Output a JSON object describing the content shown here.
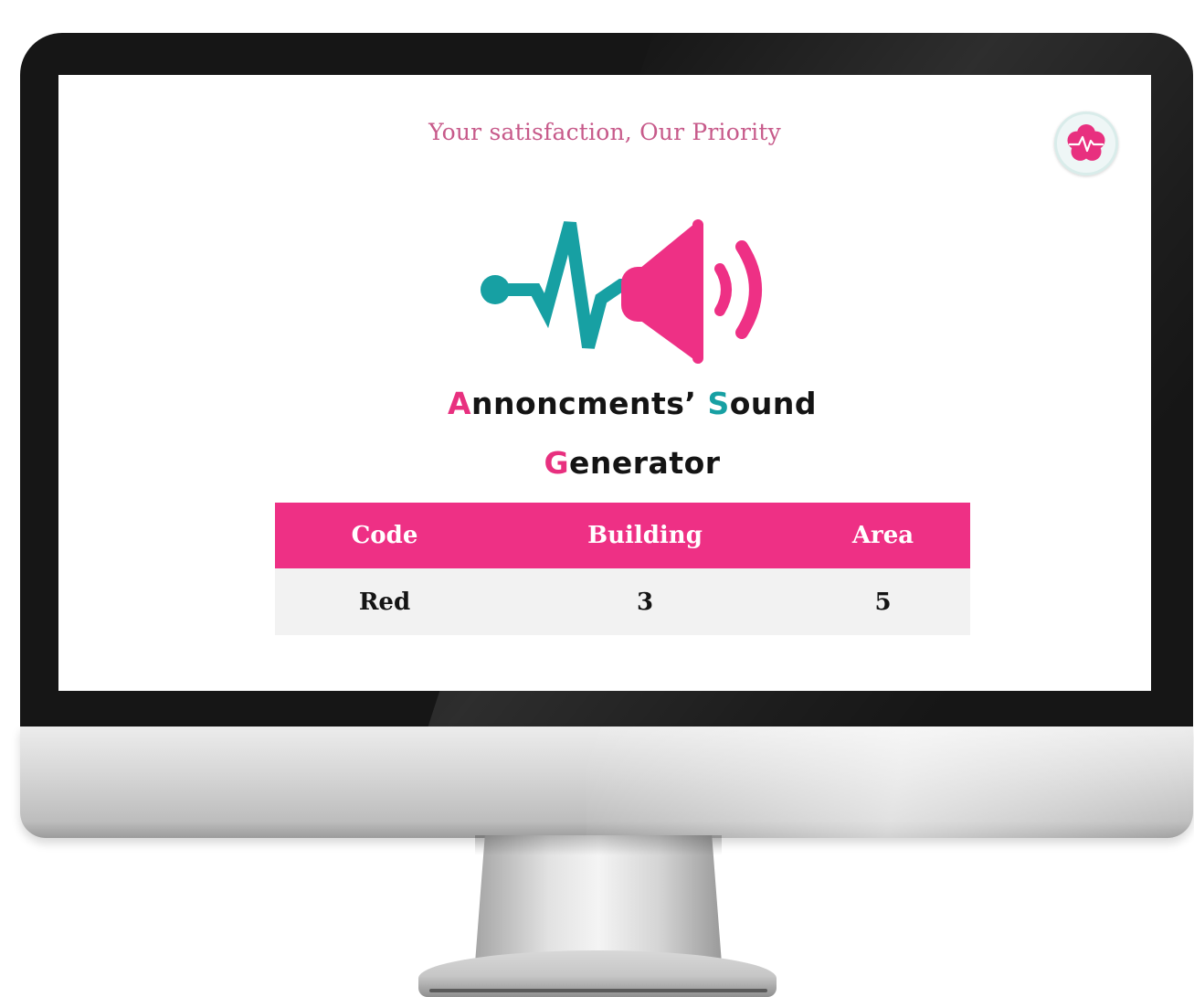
{
  "screen": {
    "tagline": "Your satisfaction, Our Priority",
    "title": {
      "line1_accent": "A",
      "line1_rest_a": "nnoncments’ ",
      "line1_accent2": "S",
      "line1_rest_b": "ound",
      "line2_accent": "G",
      "line2_rest": "enerator"
    },
    "table": {
      "headers": [
        "Code",
        "Building",
        "Area"
      ],
      "rows": [
        [
          "Red",
          "3",
          "5"
        ]
      ]
    }
  },
  "icons": {
    "logo": "medical-star-heartbeat-icon",
    "hero": "heartbeat-speaker-icon"
  },
  "colors": {
    "pink": "#ee3085",
    "teal": "#17a0a3",
    "tagline": "#c75a8a",
    "row_bg": "#f2f2f2"
  }
}
